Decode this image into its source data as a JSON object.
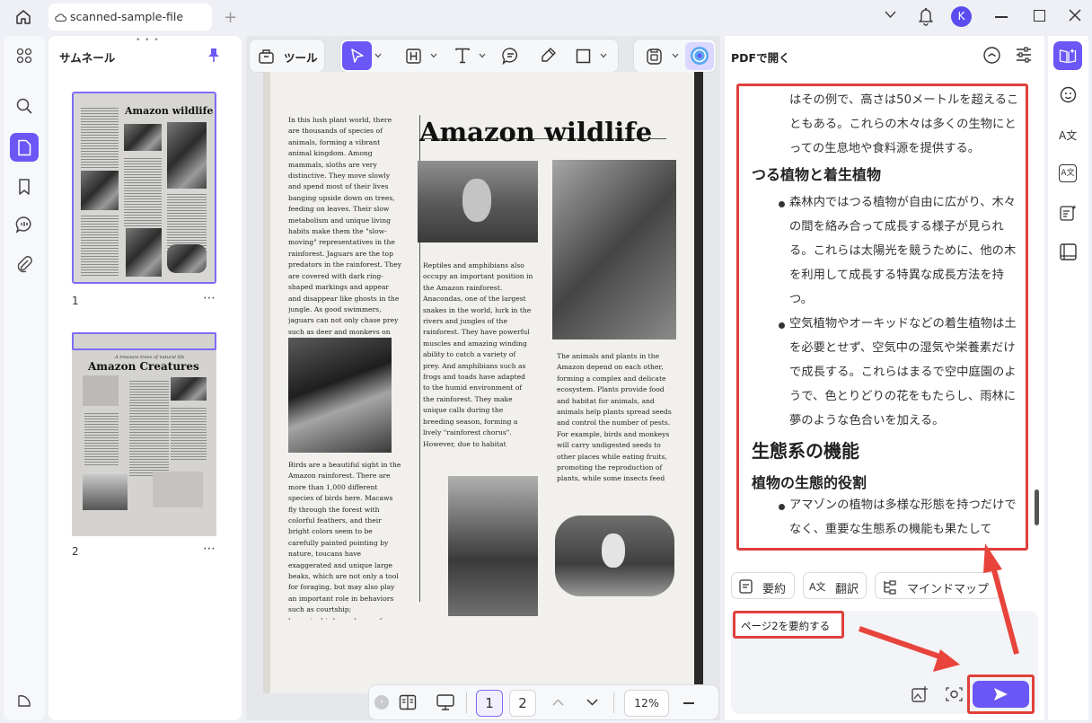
{
  "window": {
    "tab_title": "scanned-sample-file",
    "avatar_letter": "K"
  },
  "thumbnails": {
    "title": "サムネール",
    "pages": [
      {
        "number": "1",
        "heading": "Amazon wildlife"
      },
      {
        "number": "2",
        "heading": "Amazon Creatures",
        "subheading": "A treasure trove of natural life"
      }
    ]
  },
  "toolbar": {
    "tools_label": "ツール"
  },
  "document": {
    "title": "Amazon wildlife",
    "col1_top": "In this lush plant world, there are thousands of species of animals, forming a vibrant animal kingdom. Among mammals, sloths are very distinctive. They move slowly and spend most of their lives banging upside down on trees, feeding on leaves. Their slow metabolism and unique living habits make them the \"slow-moving\" representatives in the rainforest. Jaguars are the top predators in the rainforest. They are covered with dark ring-shaped markings and appear and disappear like ghosts in the jungle. As good swimmers, jaguars can not only chase prey such as deer and monkeys on land, but also catch fish, turtles and small crocodiles in the water.",
    "col1_bottom": "Birds are a beautiful sight in the Amazon rainforest. There are more than 1,000 different species of birds here. Macaws fly through the forest with colorful feathers, and their bright colors seem to be carefully painted pointing by nature, toucans have exaggerated and unique large beaks, which are not only a tool for foraging, but may also play an important role in behaviors such as courtship; hummingbirds are known for their light posture and fast-beating wings. They can hover in the air to suck nectar, showing extraordinary flying skills.",
    "col2": "Reptiles and amphibians also occupy an important position in the Amazon rainforest. Anacondas, one of the largest snakes in the world, lurk in the rivers and jungles of the rainforest. They have powerful muscles and amazing winding ability to catch a variety of prey. And amphibians such as frogs and toads have adapted to the humid environment of the rainforest. They make unique calls during the breeding season, forming a lively \"rainforest chorus\". However, due to habitat destruction and environmental changes, many amphibian populations are facing serious threats.",
    "col3": "The animals and plants in the Amazon depend on each other, forming a complex and delicate ecosystem. Plants provide food and habitat for animals, and animals help plants spread seeds and control the number of pests. For example, birds and monkeys will carry undigested seeds to other places while eating fruits, promoting the reproduction of plants, while some insects feed on the nectar of plants and help plants complete pollination in the process of collecting nectar."
  },
  "pager": {
    "page1": "1",
    "page2": "2",
    "zoom": "12%"
  },
  "ai_panel": {
    "title": "PDFで開く",
    "content": {
      "p1": "はその例で、高さは50メートルを超えることもある。これらの木々は多くの生物にとっての生息地や食料源を提供する。",
      "h_vines": "つる植物と着生植物",
      "b1": "森林内ではつる植物が自由に広がり、木々の間を絡み合って成長する様子が見られる。これらは太陽光を競うために、他の木を利用して成長する特異な成長方法を持つ。",
      "b2": "空気植物やオーキッドなどの着生植物は土を必要とせず、空気中の湿気や栄養素だけで成長する。これらはまるで空中庭園のようで、色とりどりの花をもたらし、雨林に夢のような色合いを加える。",
      "h_ecosystem": "生態系の機能",
      "h_role": "植物の生態的役割",
      "b3": "アマゾンの植物は多様な形態を持つだけでなく、重要な生態系の機能も果たして"
    },
    "chips": [
      "要約",
      "翻訳",
      "マインドマップ"
    ],
    "prompt": "ページ2を要約する"
  },
  "colors": {
    "accent": "#6b57f5",
    "highlight": "#e0403c"
  }
}
